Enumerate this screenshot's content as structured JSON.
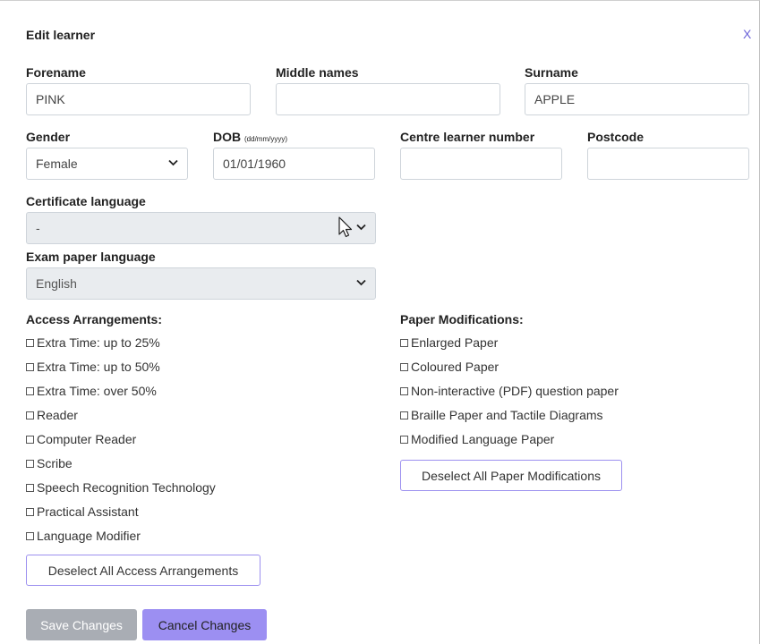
{
  "dialog": {
    "title": "Edit learner",
    "close_label": "X"
  },
  "fields": {
    "forename": {
      "label": "Forename",
      "value": "PINK"
    },
    "middle_names": {
      "label": "Middle names",
      "value": ""
    },
    "surname": {
      "label": "Surname",
      "value": "APPLE"
    },
    "gender": {
      "label": "Gender",
      "value": "Female"
    },
    "dob": {
      "label": "DOB",
      "format_hint": "(dd/mm/yyyy)",
      "value": "01/01/1960"
    },
    "centre_learner_number": {
      "label": "Centre learner number",
      "value": ""
    },
    "postcode": {
      "label": "Postcode",
      "value": ""
    },
    "certificate_language": {
      "label": "Certificate language",
      "value": "-"
    },
    "exam_paper_language": {
      "label": "Exam paper language",
      "value": "English"
    }
  },
  "access_arrangements": {
    "heading": "Access Arrangements:",
    "items": [
      "Extra Time: up to 25%",
      "Extra Time: up to 50%",
      "Extra Time: over 50%",
      "Reader",
      "Computer Reader",
      "Scribe",
      "Speech Recognition Technology",
      "Practical Assistant",
      "Language Modifier"
    ],
    "deselect_label": "Deselect All Access Arrangements"
  },
  "paper_modifications": {
    "heading": "Paper Modifications:",
    "items": [
      "Enlarged Paper",
      "Coloured Paper",
      "Non-interactive (PDF) question paper",
      "Braille Paper and Tactile Diagrams",
      "Modified Language Paper"
    ],
    "deselect_label": "Deselect All Paper Modifications"
  },
  "actions": {
    "save_label": "Save Changes",
    "cancel_label": "Cancel Changes"
  },
  "colors": {
    "accent": "#9c8ff2",
    "close": "#6b62d8",
    "disabled_button": "#a9adb4",
    "disabled_field": "#e9ecef"
  }
}
